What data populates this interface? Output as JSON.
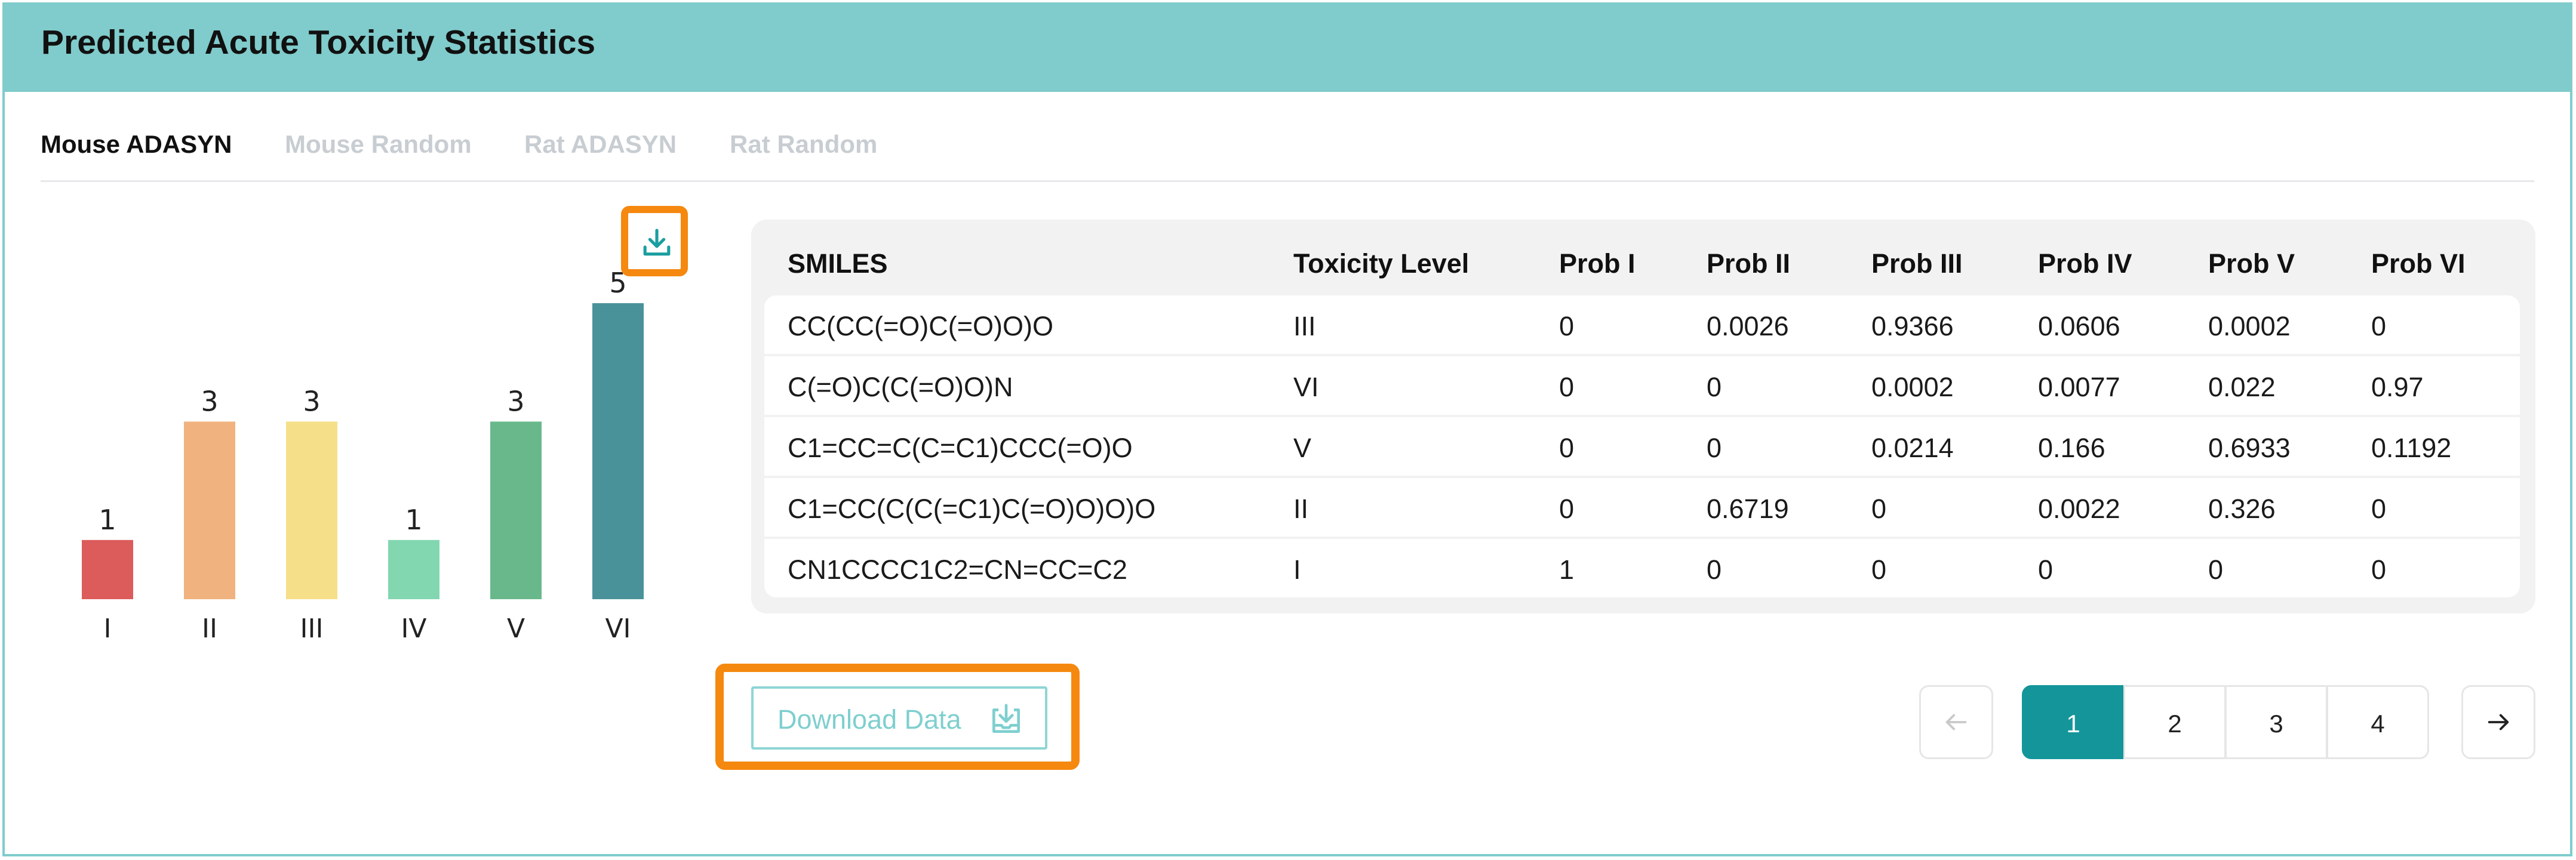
{
  "header": {
    "title": "Predicted Acute Toxicity Statistics"
  },
  "tabs": [
    {
      "label": "Mouse ADASYN",
      "active": true
    },
    {
      "label": "Mouse Random",
      "active": false
    },
    {
      "label": "Rat ADASYN",
      "active": false
    },
    {
      "label": "Rat Random",
      "active": false
    }
  ],
  "chart_data": {
    "type": "bar",
    "categories": [
      "I",
      "II",
      "III",
      "IV",
      "V",
      "VI"
    ],
    "values": [
      1,
      3,
      3,
      1,
      3,
      5
    ],
    "colors": [
      "#dc5b5b",
      "#f0b27e",
      "#f5df88",
      "#82d7b0",
      "#68b88c",
      "#4a929a"
    ],
    "ylim": [
      0,
      5
    ]
  },
  "chart_download": {
    "icon": "download-icon"
  },
  "table": {
    "columns": [
      "SMILES",
      "Toxicity Level",
      "Prob I",
      "Prob II",
      "Prob III",
      "Prob IV",
      "Prob V",
      "Prob VI"
    ],
    "rows": [
      [
        "CC(CC(=O)C(=O)O)O",
        "III",
        "0",
        "0.0026",
        "0.9366",
        "0.0606",
        "0.0002",
        "0"
      ],
      [
        "C(=O)C(C(=O)O)N",
        "VI",
        "0",
        "0",
        "0.0002",
        "0.0077",
        "0.022",
        "0.97"
      ],
      [
        "C1=CC=C(C=C1)CCC(=O)O",
        "V",
        "0",
        "0",
        "0.0214",
        "0.166",
        "0.6933",
        "0.1192"
      ],
      [
        "C1=CC(C(C(=C1)C(=O)O)O)O",
        "II",
        "0",
        "0.6719",
        "0",
        "0.0022",
        "0.326",
        "0"
      ],
      [
        "CN1CCCC1C2=CN=CC=C2",
        "I",
        "1",
        "0",
        "0",
        "0",
        "0",
        "0"
      ]
    ]
  },
  "download_data": {
    "label": "Download Data",
    "icon": "download-tray-icon"
  },
  "pagination": {
    "pages": [
      "1",
      "2",
      "3",
      "4"
    ],
    "current": "1",
    "prev_icon": "arrow-left-icon",
    "next_icon": "arrow-right-icon"
  }
}
